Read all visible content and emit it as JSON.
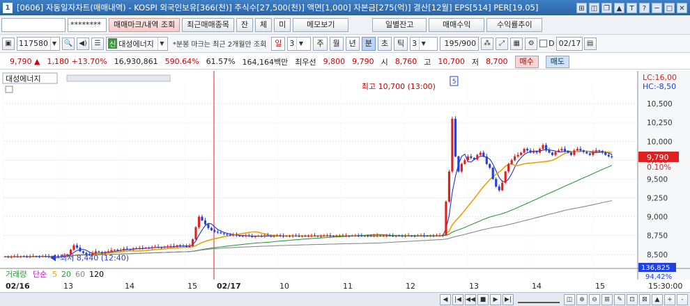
{
  "window": {
    "number": "1",
    "title": "[0606] 자동일자차트(매매내역) - KOSPI 외국인보유[366(천)] 주식수[27,500(천)] 액면[1,000] 자본금[275(억)] 결산[12월] EPS[514] PER[19.05]",
    "icons": [
      "⊞",
      "◫",
      "❐",
      "▲",
      "T",
      "?",
      "─",
      "□",
      "✕"
    ]
  },
  "buttons": {
    "account_mask": "********",
    "trade_mark": "매매마크/내역 조회",
    "recent_trades": "최근매매종목",
    "balance": "잔",
    "fill": "체",
    "unfilled": "미",
    "memo": "메모보기",
    "daily_balance": "일별잔고",
    "trade_profit": "매매수익",
    "return_trend": "수익률추이"
  },
  "toolbar": {
    "code": "117580",
    "badge": "신",
    "stock_name": "대성에너지",
    "note": "*분봉 마크는 최근 2개월만 조회",
    "period_label": "일",
    "period_value": "3",
    "tabs": [
      "주",
      "월",
      "년",
      "분",
      "초",
      "틱"
    ],
    "interval": "3",
    "count": "195/900",
    "date_check": "D",
    "date": "02/17"
  },
  "quote": {
    "price": "9,790",
    "arrow": "▲",
    "change": "1,180",
    "change_pct": "+13.70%",
    "volume": "16,930,861",
    "vol_ratio": "590.64%",
    "rate": "61.57%",
    "amount": "164,164백만",
    "best_ask_label": "최우선",
    "best_ask": "9,800",
    "best_bid": "9,790",
    "open_label": "시",
    "open": "8,760",
    "high_label": "고",
    "high": "10,700",
    "low_label": "저",
    "low": "8,700",
    "buy": "매수",
    "sell": "매도"
  },
  "chart_data": {
    "type": "candlestick",
    "stock_label": "대성에너지",
    "limit_up": "LC:16,00",
    "limit_hold": "HC:-8,50",
    "high_annotation": "최고 10,700 (13:00)",
    "high_marker": "5",
    "low_annotation": "최저 8,440 (12:40)",
    "current_price_label": "9,790",
    "current_pct_label": "0.10%",
    "yaxis": [
      "10,500",
      "10,250",
      "10,000",
      "9,750",
      "9,500",
      "9,250",
      "9,000",
      "8,750",
      "8,500"
    ],
    "ylim": [
      8350,
      10750
    ],
    "xaxis": [
      "02/16",
      "13",
      "14",
      "15",
      "02/17",
      "10",
      "11",
      "12",
      "13",
      "14",
      "15"
    ],
    "time_label": "15:30:00",
    "volume_legend": {
      "label": "거래량",
      "ma_label": "단순",
      "periods": [
        "5",
        "20",
        "60",
        "120"
      ]
    },
    "volume_axis": "136,825",
    "volume_pct": "94.42%",
    "colors": {
      "up": "#e02020",
      "down": "#2040e0",
      "ma5": "#2233cc",
      "ma20": "#f0a000",
      "ma60": "#2a9a3a",
      "ma120": "#888888",
      "cursor": "#e02020"
    },
    "prices": [
      8470,
      8465,
      8468,
      8472,
      8470,
      8474,
      8470,
      8468,
      8471,
      8475,
      8473,
      8470,
      8476,
      8472,
      8469,
      8474,
      8478,
      8474,
      8472,
      8480,
      8500,
      8560,
      8620,
      8590,
      8540,
      8520,
      8500,
      8490,
      8520,
      8540,
      8530,
      8515,
      8525,
      8540,
      8555,
      8560,
      8550,
      8560,
      8575,
      8570,
      8565,
      8580,
      8575,
      8585,
      8580,
      8590,
      8585,
      8595,
      8600,
      8595,
      8590,
      8600,
      8605,
      8610,
      8600,
      8620,
      8615,
      8610,
      8605,
      8610,
      8700,
      8860,
      9000,
      8950,
      8900,
      8850,
      8820,
      8800,
      8790,
      8780,
      8770,
      8760,
      8750,
      8760,
      8750,
      8740,
      8745,
      8750,
      8740,
      8735,
      8740,
      8745,
      8740,
      8750,
      8745,
      8740,
      8745,
      8750,
      8745,
      8740,
      8745,
      8740,
      8748,
      8745,
      8742,
      8746,
      8740,
      8745,
      8748,
      8745,
      8742,
      8745,
      8748,
      8750,
      8745,
      8742,
      8746,
      8748,
      8744,
      8746,
      8745,
      8748,
      8750,
      8746,
      8744,
      8748,
      8745,
      8742,
      8746,
      8748,
      8745,
      8747,
      8750,
      8746,
      8744,
      8748,
      8746,
      8742,
      8745,
      8748,
      8746,
      8744,
      8748,
      8750,
      8746,
      8745,
      8748,
      8746,
      8748,
      8750,
      8760,
      9200,
      9600,
      10300,
      9800,
      9600,
      9700,
      9750,
      9800,
      9780,
      9760,
      9820,
      9850,
      9800,
      9700,
      9650,
      9500,
      9400,
      9350,
      9450,
      9600,
      9700,
      9750,
      9800,
      9820,
      9850,
      9900,
      9880,
      9850,
      9870,
      9850,
      9900,
      9950,
      9880,
      9850,
      9820,
      9860,
      9880,
      9900,
      9870,
      9850,
      9820,
      9880,
      9900,
      9880,
      9860,
      9840,
      9820,
      9860,
      9880,
      9870,
      9850,
      9820,
      9800,
      9790
    ]
  },
  "bottombar": {
    "icons": [
      "◀",
      "|◀",
      "◀◀",
      "■",
      "▶",
      "▶|",
      "⊢",
      "◫",
      "⊕",
      "⊖",
      "⊞",
      "✎",
      "⊡",
      "⊠",
      "▲",
      "+",
      "-"
    ]
  }
}
